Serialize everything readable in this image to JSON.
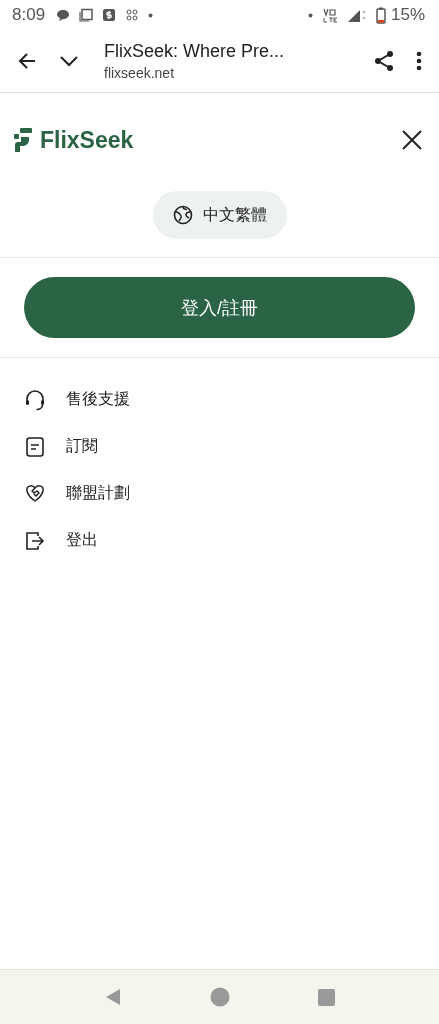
{
  "status_bar": {
    "time": "8:09",
    "battery": "15%"
  },
  "browser_bar": {
    "title": "FlixSeek: Where Pre...",
    "url": "flixseek.net"
  },
  "header": {
    "logo": "FlixSeek"
  },
  "language": {
    "label": "中文繁體"
  },
  "login_button": "登入/註冊",
  "menu": [
    {
      "kind": "support",
      "label": "售後支援"
    },
    {
      "kind": "subscribe",
      "label": "訂閱"
    },
    {
      "kind": "affiliate",
      "label": "聯盟計劃"
    },
    {
      "kind": "logout",
      "label": "登出"
    }
  ]
}
